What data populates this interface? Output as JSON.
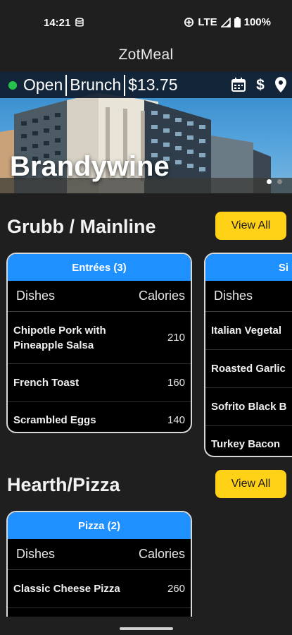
{
  "status_bar": {
    "time": "14:21",
    "network": "LTE",
    "battery": "100%"
  },
  "app": {
    "title": "ZotMeal"
  },
  "hall": {
    "status": "Open",
    "meal_period": "Brunch",
    "price": "$13.75",
    "name": "Brandywine",
    "status_color": "#27c24c"
  },
  "stations": [
    {
      "name": "Grubb / Mainline",
      "view_all": "View All",
      "cards": [
        {
          "header": "Entrées (3)",
          "col_dishes": "Dishes",
          "col_calories": "Calories",
          "items": [
            {
              "dish": "Chipotle Pork with Pineapple Salsa",
              "calories": "210"
            },
            {
              "dish": "French Toast",
              "calories": "160"
            },
            {
              "dish": "Scrambled Eggs",
              "calories": "140"
            }
          ]
        },
        {
          "header": "Si",
          "col_dishes": "Dishes",
          "col_calories": "",
          "items": [
            {
              "dish": "Italian Vegetal",
              "calories": ""
            },
            {
              "dish": "Roasted Garlic",
              "calories": ""
            },
            {
              "dish": "Sofrito Black B",
              "calories": ""
            },
            {
              "dish": "Turkey Bacon",
              "calories": ""
            }
          ]
        }
      ]
    },
    {
      "name": "Hearth/Pizza",
      "view_all": "View All",
      "cards": [
        {
          "header": "Pizza (2)",
          "col_dishes": "Dishes",
          "col_calories": "Calories",
          "items": [
            {
              "dish": "Classic Cheese Pizza",
              "calories": "260"
            }
          ]
        }
      ]
    }
  ],
  "colors": {
    "accent": "#1e90ff",
    "button": "#ffd218",
    "background": "#1f1f1f"
  }
}
